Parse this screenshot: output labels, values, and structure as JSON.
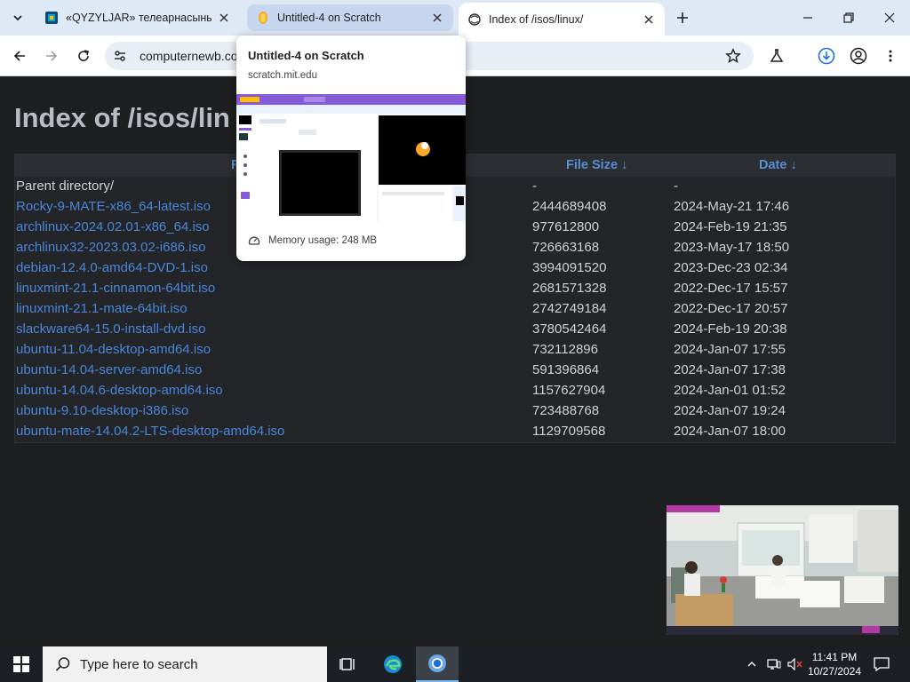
{
  "browser": {
    "tabs": [
      {
        "title": "«QYZYLJAR» телеарнасының р",
        "favicon": "qyzyljar-favicon"
      },
      {
        "title": "Untitled-4 on Scratch",
        "favicon": "scratch-favicon"
      },
      {
        "title": "Index of /isos/linux/",
        "favicon": "server-favicon"
      }
    ],
    "active_tab": 2,
    "url": "computernewb.co"
  },
  "hover_card": {
    "title": "Untitled-4 on Scratch",
    "domain": "scratch.mit.edu",
    "memory": "Memory usage: 248 MB"
  },
  "page": {
    "heading": "Index of /isos/lin",
    "columns": {
      "name": "F",
      "size": "File Size  ↓",
      "date": "Date  ↓"
    },
    "parent": {
      "name": "Parent directory/",
      "size": "-",
      "date": "-"
    },
    "files": [
      {
        "name": "Rocky-9-MATE-x86_64-latest.iso",
        "size": "2444689408",
        "date": "2024-May-21 17:46"
      },
      {
        "name": "archlinux-2024.02.01-x86_64.iso",
        "size": "977612800",
        "date": "2024-Feb-19 21:35"
      },
      {
        "name": "archlinux32-2023.03.02-i686.iso",
        "size": "726663168",
        "date": "2023-May-17 18:50"
      },
      {
        "name": "debian-12.4.0-amd64-DVD-1.iso",
        "size": "3994091520",
        "date": "2023-Dec-23 02:34"
      },
      {
        "name": "linuxmint-21.1-cinnamon-64bit.iso",
        "size": "2681571328",
        "date": "2022-Dec-17 15:57"
      },
      {
        "name": "linuxmint-21.1-mate-64bit.iso",
        "size": "2742749184",
        "date": "2022-Dec-17 20:57"
      },
      {
        "name": "slackware64-15.0-install-dvd.iso",
        "size": "3780542464",
        "date": "2024-Feb-19 20:38"
      },
      {
        "name": "ubuntu-11.04-desktop-amd64.iso",
        "size": "732112896",
        "date": "2024-Jan-07 17:55"
      },
      {
        "name": "ubuntu-14.04-server-amd64.iso",
        "size": "591396864",
        "date": "2024-Jan-07 17:38"
      },
      {
        "name": "ubuntu-14.04.6-desktop-amd64.iso",
        "size": "1157627904",
        "date": "2024-Jan-01 01:52"
      },
      {
        "name": "ubuntu-9.10-desktop-i386.iso",
        "size": "723488768",
        "date": "2024-Jan-07 19:24"
      },
      {
        "name": "ubuntu-mate-14.04.2-LTS-desktop-amd64.iso",
        "size": "1129709568",
        "date": "2024-Jan-07 18:00"
      }
    ]
  },
  "taskbar": {
    "search_placeholder": "Type here to search",
    "time": "11:41 PM",
    "date": "10/27/2024"
  },
  "colors": {
    "link": "#4a86d9",
    "header_text": "#5b8fd3",
    "page_bg": "#1e1f20",
    "tabstrip_bg": "#dfe8f5"
  }
}
